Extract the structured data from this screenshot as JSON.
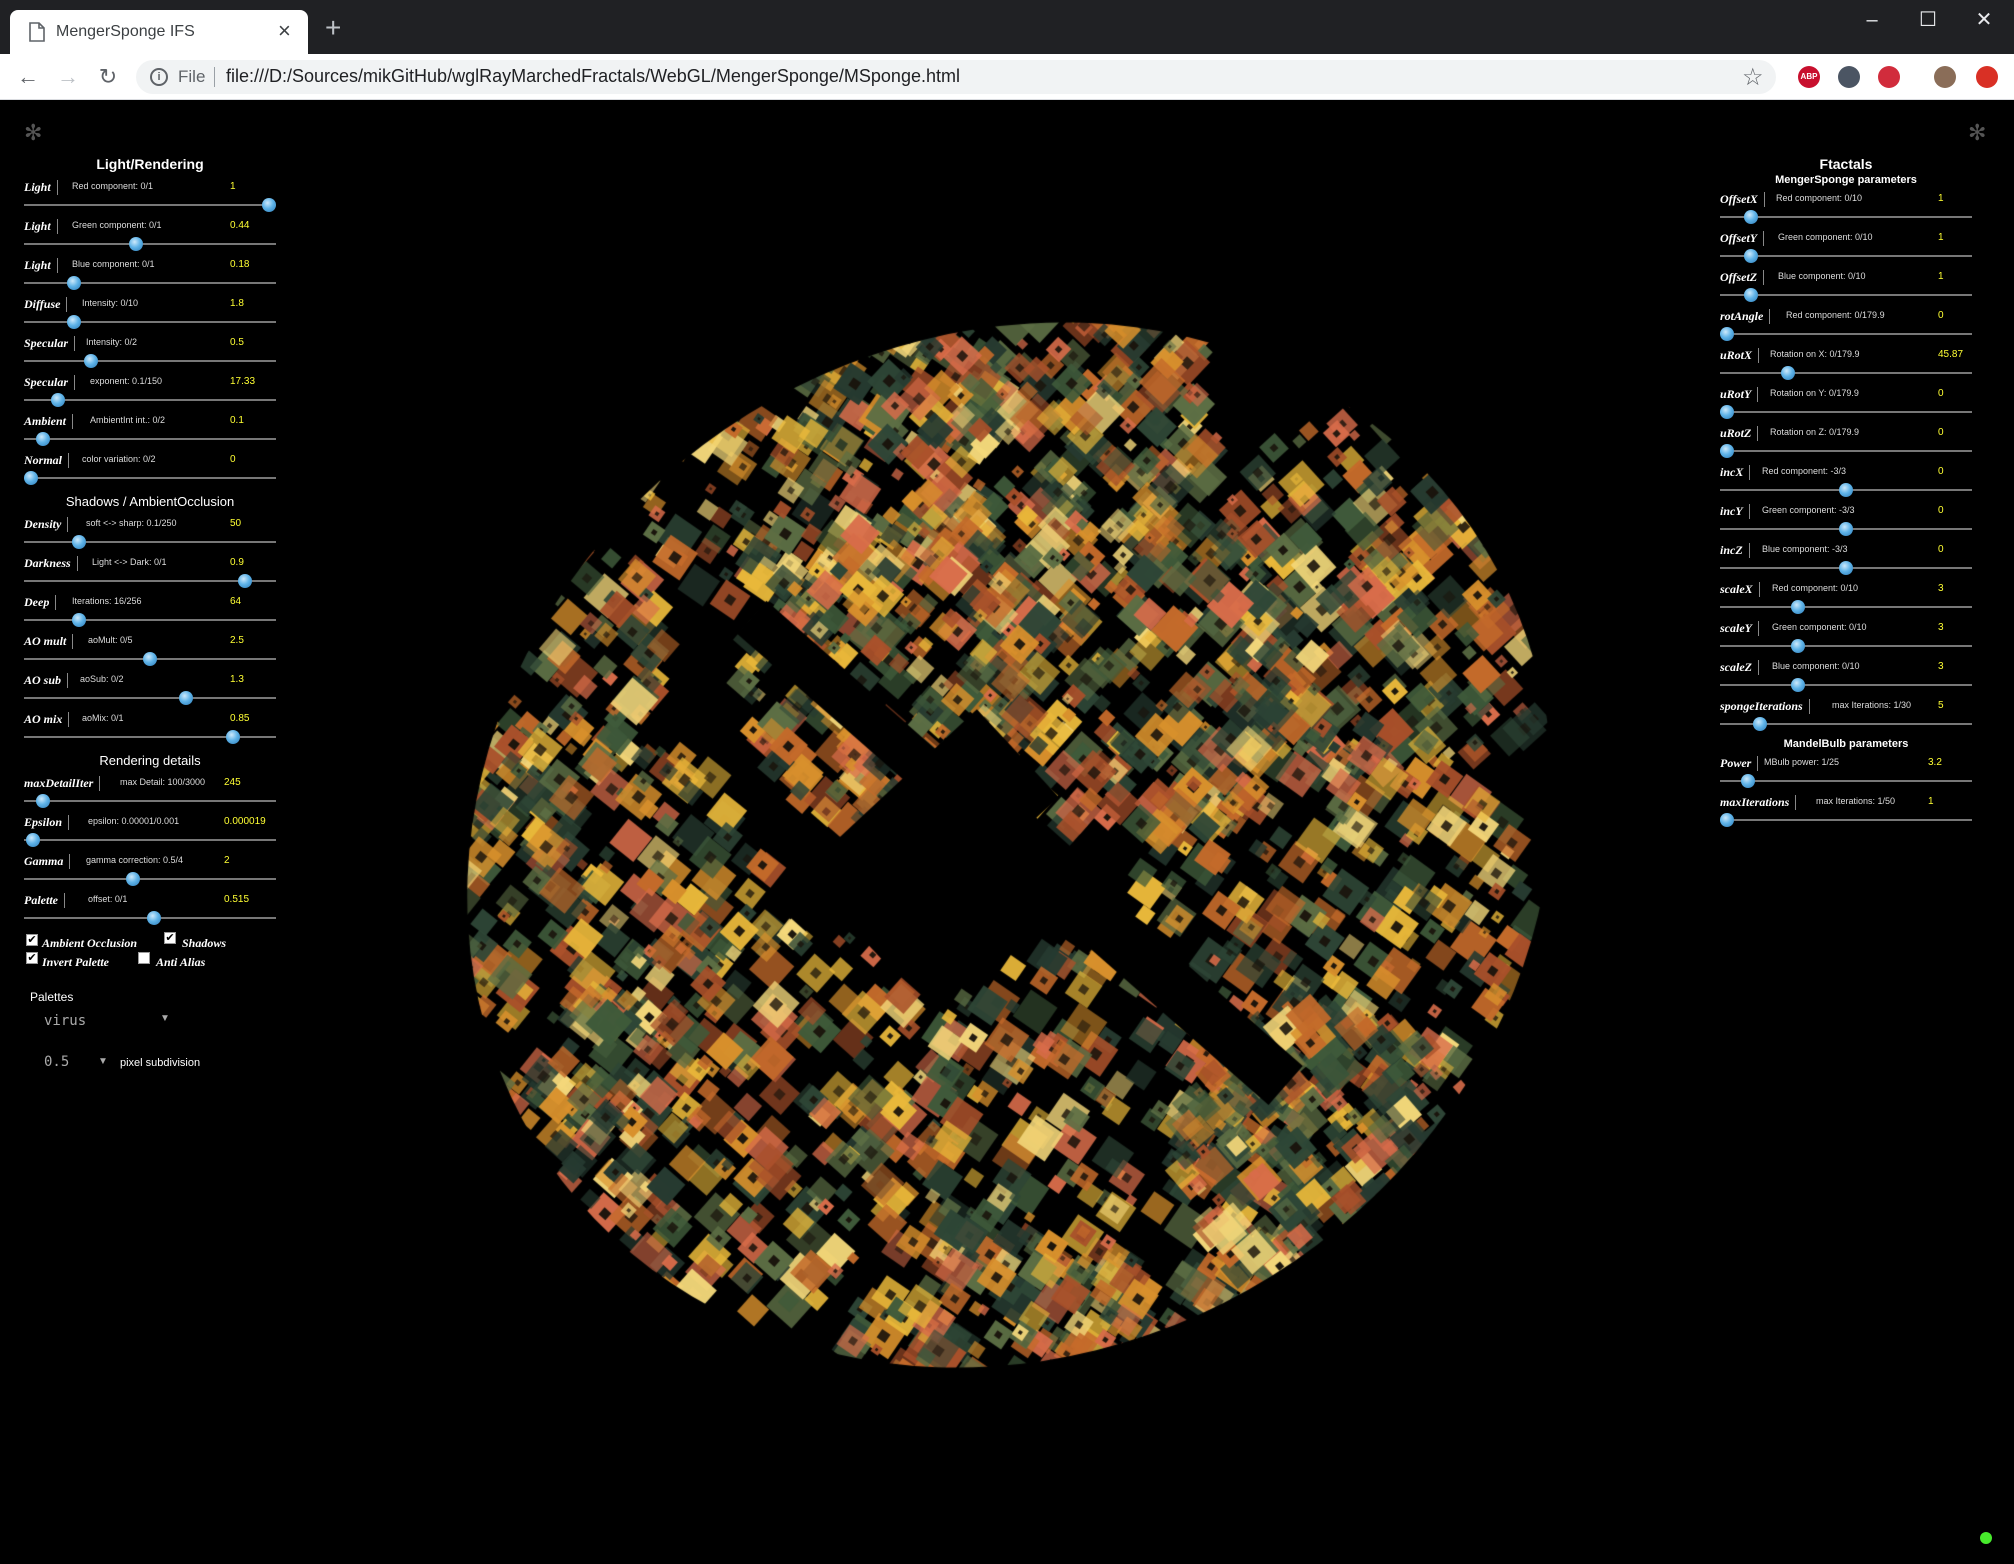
{
  "browser": {
    "tab_title": "MengerSponge IFS",
    "new_tab_icon": "+",
    "url_scheme": "File",
    "url": "file:///D:/Sources/mikGitHub/wglRayMarchedFractals/WebGL/MengerSponge/MSponge.html",
    "extensions": [
      {
        "name": "adblock-icon",
        "label": "ABP",
        "color": "#c8102e"
      },
      {
        "name": "screen-reader-icon",
        "label": "",
        "color": "#4b5563"
      },
      {
        "name": "pocket-icon",
        "label": "",
        "color": "#d12c3c"
      },
      {
        "name": "avatar-icon",
        "label": "",
        "color": "#8a6d58"
      },
      {
        "name": "update-icon",
        "label": "",
        "color": "#d93025"
      }
    ]
  },
  "left_panel": {
    "light_title": "Light/Rendering",
    "light_params": [
      {
        "name": "Light",
        "desc": "Red component: 0/1",
        "value": "1",
        "frac": 1.0
      },
      {
        "name": "Light",
        "desc": "Green component: 0/1",
        "value": "0.44",
        "frac": 0.44
      },
      {
        "name": "Light",
        "desc": "Blue component: 0/1",
        "value": "0.18",
        "frac": 0.18
      },
      {
        "name": "Diffuse",
        "desc": "Intensity: 0/10",
        "value": "1.8",
        "frac": 0.18
      },
      {
        "name": "Specular",
        "desc": "Intensity: 0/2",
        "value": "0.5",
        "frac": 0.25
      },
      {
        "name": "Specular",
        "desc": "exponent: 0.1/150",
        "value": "17.33",
        "frac": 0.115
      },
      {
        "name": "Ambient",
        "desc": "AmbientInt int.: 0/2",
        "value": "0.1",
        "frac": 0.05
      },
      {
        "name": "Normal",
        "desc": "color variation: 0/2",
        "value": "0",
        "frac": 0.0
      }
    ],
    "shadow_title": "Shadows / AmbientOcclusion",
    "shadow_params": [
      {
        "name": "Density",
        "desc": "soft <-> sharp: 0.1/250",
        "value": "50",
        "frac": 0.2
      },
      {
        "name": "Darkness",
        "desc": "Light <-> Dark: 0/1",
        "value": "0.9",
        "frac": 0.9
      },
      {
        "name": "Deep",
        "desc": "Iterations: 16/256",
        "value": "64",
        "frac": 0.2
      },
      {
        "name": "AO mult",
        "desc": "aoMult: 0/5",
        "value": "2.5",
        "frac": 0.5
      },
      {
        "name": "AO sub",
        "desc": "aoSub: 0/2",
        "value": "1.3",
        "frac": 0.65
      },
      {
        "name": "AO mix",
        "desc": "aoMix: 0/1",
        "value": "0.85",
        "frac": 0.85
      }
    ],
    "render_title": "Rendering details",
    "render_params": [
      {
        "name": "maxDetailIter",
        "desc": "max Detail: 100/3000",
        "value": "245",
        "frac": 0.05
      },
      {
        "name": "Epsilon",
        "desc": "epsilon: 0.00001/0.001",
        "value": "0.000019",
        "frac": 0.01
      },
      {
        "name": "Gamma",
        "desc": "gamma correction: 0.5/4",
        "value": "2",
        "frac": 0.43
      },
      {
        "name": "Palette",
        "desc": "offset: 0/1",
        "value": "0.515",
        "frac": 0.515
      }
    ],
    "checkboxes": [
      {
        "label": "Ambient Occlusion",
        "checked": true
      },
      {
        "label": "Shadows",
        "checked": true
      },
      {
        "label": "Invert Palette",
        "checked": true
      },
      {
        "label": "Anti Alias",
        "checked": false
      }
    ],
    "palettes_label": "Palettes",
    "palette_value": "virus",
    "subdivision_value": "0.5",
    "subdivision_label": "pixel subdivision"
  },
  "right_panel": {
    "title": "Ftactals",
    "sponge_title": "MengerSponge parameters",
    "sponge_params": [
      {
        "name": "OffsetX",
        "desc": "Red component: 0/10",
        "value": "1",
        "frac": 0.1
      },
      {
        "name": "OffsetY",
        "desc": "Green component: 0/10",
        "value": "1",
        "frac": 0.1
      },
      {
        "name": "OffsetZ",
        "desc": "Blue component: 0/10",
        "value": "1",
        "frac": 0.1
      },
      {
        "name": "rotAngle",
        "desc": "Red component: 0/179.9",
        "value": "0",
        "frac": 0.0
      },
      {
        "name": "uRotX",
        "desc": "Rotation on X: 0/179.9",
        "value": "45.87",
        "frac": 0.255
      },
      {
        "name": "uRotY",
        "desc": "Rotation on Y: 0/179.9",
        "value": "0",
        "frac": 0.0
      },
      {
        "name": "uRotZ",
        "desc": "Rotation on Z: 0/179.9",
        "value": "0",
        "frac": 0.0
      },
      {
        "name": "incX",
        "desc": "Red component: -3/3",
        "value": "0",
        "frac": 0.5
      },
      {
        "name": "incY",
        "desc": "Green component: -3/3",
        "value": "0",
        "frac": 0.5
      },
      {
        "name": "incZ",
        "desc": "Blue component: -3/3",
        "value": "0",
        "frac": 0.5
      },
      {
        "name": "scaleX",
        "desc": "Red component: 0/10",
        "value": "3",
        "frac": 0.3
      },
      {
        "name": "scaleY",
        "desc": "Green component: 0/10",
        "value": "3",
        "frac": 0.3
      },
      {
        "name": "scaleZ",
        "desc": "Blue component: 0/10",
        "value": "3",
        "frac": 0.3
      },
      {
        "name": "spongeIterations",
        "desc": "max Iterations: 1/30",
        "value": "5",
        "frac": 0.14
      }
    ],
    "mandel_title": "MandelBulb parameters",
    "mandel_params": [
      {
        "name": "Power",
        "desc": "MBulb power: 1/25",
        "value": "3.2",
        "frac": 0.09
      },
      {
        "name": "maxIterations",
        "desc": "max Iterations: 1/50",
        "value": "1",
        "frac": 0.0
      }
    ]
  }
}
